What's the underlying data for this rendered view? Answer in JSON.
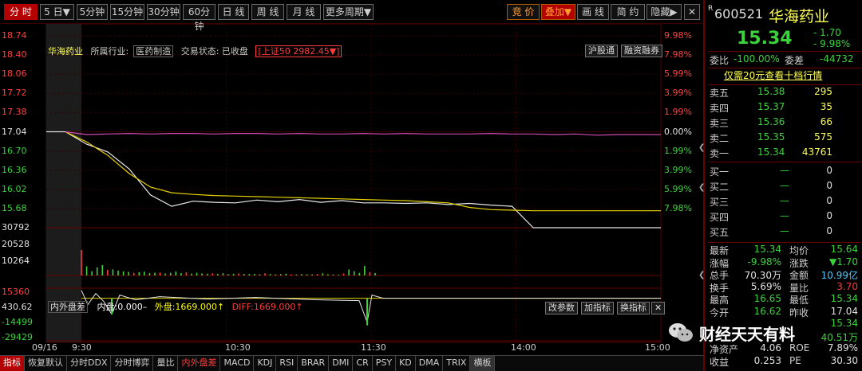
{
  "toolbar": {
    "buttons": [
      "分 时",
      "5 日▼",
      "5分钟",
      "15分钟",
      "30分钟",
      "60分钟",
      "日 线",
      "周 线",
      "月 线",
      "更多周期▼"
    ],
    "right_buttons": [
      "竞 价",
      "叠加▼",
      "画 线",
      "简 约",
      "隐藏▶"
    ]
  },
  "header": {
    "stock": "华海药业",
    "industry": "所属行业:",
    "industry_value": "医药制造",
    "trade_state": "交易状态: 已收盘",
    "index_overlay": "[上证50 2982.45▼]",
    "chip_hgt": "沪股通",
    "chip_rzrq": "融资融券"
  },
  "chart_data": [
    {
      "type": "line",
      "title": "",
      "x": [
        "09:30",
        "10:30",
        "11:30",
        "14:00",
        "15:00"
      ],
      "x_start_label": "09/16",
      "ylim": [
        15.34,
        18.74
      ],
      "y_ticks_left": [
        "18.74",
        "18.40",
        "18.06",
        "17.72",
        "17.38",
        "17.04",
        "16.70",
        "16.36",
        "16.02",
        "15.68"
      ],
      "y_ticks_right": [
        "9.98%",
        "7.98%",
        "5.99%",
        "3.99%",
        "1.99%",
        "0.00%",
        "1.99%",
        "3.99%",
        "5.99%",
        "7.98%"
      ],
      "prev_close": 17.04,
      "series": [
        {
          "name": "price",
          "values": [
            17.04,
            16.82,
            16.68,
            16.38,
            15.92,
            15.72,
            15.81,
            15.79,
            15.78,
            15.83,
            15.8,
            15.84,
            15.79,
            15.82,
            15.78,
            15.78,
            15.77,
            15.78,
            15.75,
            15.77,
            15.74,
            15.72,
            15.34,
            15.34,
            15.34,
            15.34,
            15.34,
            15.34,
            15.34
          ]
        },
        {
          "name": "average",
          "values": [
            17.04,
            16.86,
            16.62,
            16.3,
            16.06,
            15.96,
            15.93,
            15.91,
            15.9,
            15.89,
            15.88,
            15.87,
            15.86,
            15.85,
            15.84,
            15.83,
            15.82,
            15.8,
            15.78,
            15.7,
            15.66,
            15.65,
            15.64,
            15.64,
            15.64,
            15.64,
            15.64,
            15.64,
            15.64
          ]
        },
        {
          "name": "index_overlay",
          "values": [
            17.04,
            16.99,
            17.0,
            17.01,
            17.0,
            17.01,
            17.01,
            17.0,
            17.01,
            17.01,
            17.0,
            17.01,
            17.0,
            17.0,
            17.01,
            17.0,
            17.01,
            17.0,
            17.0,
            17.0,
            17.01,
            17.0,
            17.0,
            16.99,
            17.0,
            16.98,
            16.99,
            16.99,
            16.99
          ]
        }
      ]
    },
    {
      "type": "bar",
      "title": "volume",
      "ylim": [
        0,
        30792
      ],
      "y_ticks": [
        "30792",
        "20528",
        "10264"
      ],
      "values": [
        30792,
        11000,
        5200,
        9800,
        12600,
        6800,
        7400,
        5900,
        4800,
        4300,
        3200,
        3900,
        4600,
        2900,
        3300,
        3600,
        2400,
        3200,
        4700,
        2900,
        3800,
        2200,
        3300,
        2500,
        2100,
        2600,
        1900,
        2800,
        1600,
        2100,
        2400,
        2000,
        1700,
        1900,
        1500,
        2600,
        1800,
        1300,
        1700,
        2200,
        1500,
        1200,
        1700,
        1400,
        1300,
        1900,
        2600,
        1500,
        1200,
        1100,
        2400,
        7200,
        5200,
        3100,
        11500,
        4100,
        2900
      ]
    },
    {
      "type": "area",
      "title": "内外盘差",
      "ylim": [
        -29429,
        15360
      ],
      "y_ticks": [
        "15360",
        "430.62",
        "-14499",
        "-29429"
      ]
    }
  ],
  "indicator": {
    "name": "内外盘差",
    "inner": "内盘:0.000–",
    "outer": "外盘:1669.000↑",
    "diff": "DIFF:1669.000↑",
    "buttons": [
      "改参数",
      "加指标",
      "换指标",
      "✕"
    ]
  },
  "time_labels": [
    "09/16",
    "9:30",
    "10:30",
    "11:30",
    "14:00",
    "15:00"
  ],
  "tabs": [
    "指标",
    "恢复默认",
    "分时DDX",
    "分时博弈",
    "量比",
    "内外盘差",
    "MACD",
    "KDJ",
    "RSI",
    "BRAR",
    "DMI",
    "CR",
    "PSY",
    "KD",
    "DMA",
    "TRIX",
    "横板"
  ],
  "quote": {
    "code": "600521",
    "r_tag": "R",
    "name": "华海药业",
    "price": "15.34",
    "change": "- 1.70",
    "pct": "- 9.98%",
    "weibi_label": "委比",
    "weibi": "-100.00%",
    "weicha_label": "委差",
    "weicha": "-44732",
    "promo": "仅需20元查看十档行情",
    "sells": [
      {
        "k": "卖五",
        "p": "15.38",
        "q": "295"
      },
      {
        "k": "卖四",
        "p": "15.37",
        "q": "35"
      },
      {
        "k": "卖三",
        "p": "15.36",
        "q": "66"
      },
      {
        "k": "卖二",
        "p": "15.35",
        "q": "575"
      },
      {
        "k": "卖一",
        "p": "15.34",
        "q": "43761"
      }
    ],
    "buys": [
      {
        "k": "买一",
        "p": "—",
        "q": "0"
      },
      {
        "k": "买二",
        "p": "—",
        "q": "0"
      },
      {
        "k": "买三",
        "p": "—",
        "q": "0"
      },
      {
        "k": "买四",
        "p": "—",
        "q": "0"
      },
      {
        "k": "买五",
        "p": "—",
        "q": "0"
      }
    ],
    "stats": [
      {
        "k1": "最新",
        "v1": "15.34",
        "c1": "green",
        "k2": "均价",
        "v2": "15.64",
        "c2": "green"
      },
      {
        "k1": "涨幅",
        "v1": "-9.98%",
        "c1": "green",
        "k2": "涨跌",
        "v2": "▼1.70",
        "c2": "green"
      },
      {
        "k1": "总手",
        "v1": "70.30万",
        "c1": "white",
        "k2": "金额",
        "v2": "10.99亿",
        "c2": "cyan"
      },
      {
        "k1": "换手",
        "v1": "5.69%",
        "c1": "white",
        "k2": "量比",
        "v2": "3.70",
        "c2": "red"
      },
      {
        "k1": "最高",
        "v1": "16.65",
        "c1": "green",
        "k2": "最低",
        "v2": "15.34",
        "c2": "green"
      },
      {
        "k1": "今开",
        "v1": "16.62",
        "c1": "green",
        "k2": "昨收",
        "v2": "17.04",
        "c2": "white"
      },
      {
        "k1": "",
        "v1": "",
        "c1": "white",
        "k2": "",
        "v2": "15.34",
        "c2": "green"
      },
      {
        "k1": "",
        "v1": "",
        "c1": "white",
        "k2": "",
        "v2": "40.51万",
        "c2": "green"
      },
      {
        "k1": "净资产",
        "v1": "4.06",
        "c1": "white",
        "k2": "ROE",
        "v2": "7.89%",
        "c2": "white"
      },
      {
        "k1": "收益",
        "v1": "0.253",
        "c1": "white",
        "k2": "PE",
        "v2": "30.30",
        "c2": "white"
      }
    ]
  },
  "watermark": "财经天天有料"
}
